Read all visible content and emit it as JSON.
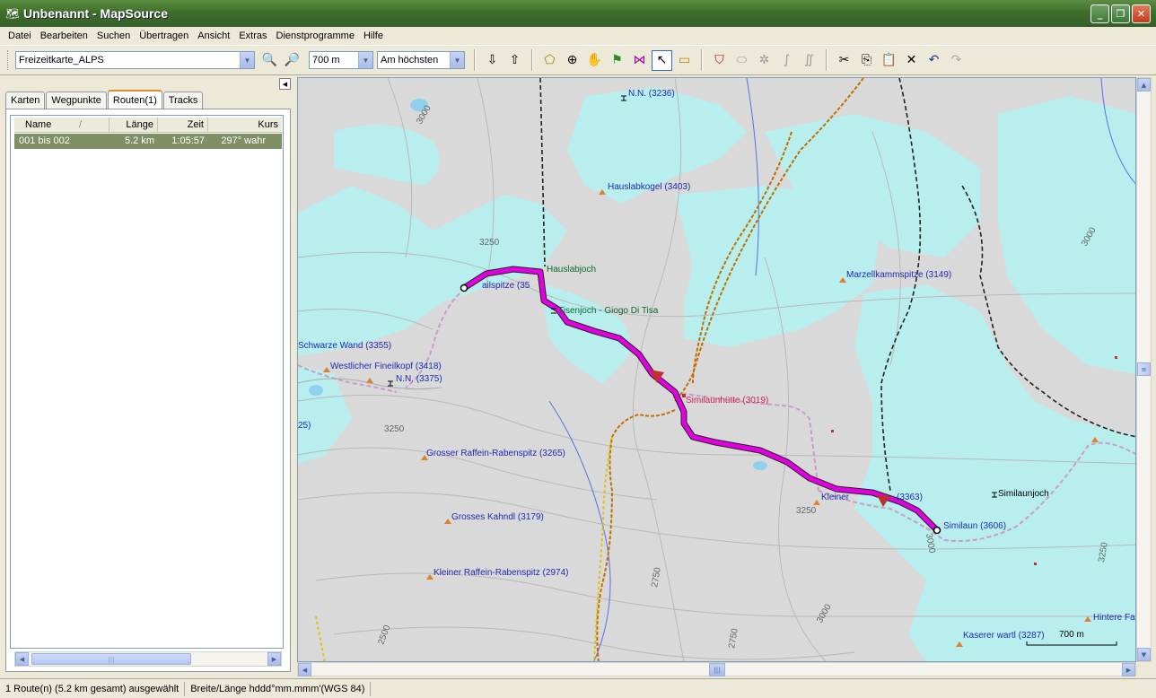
{
  "window": {
    "title": "Unbenannt - MapSource"
  },
  "menu": [
    "Datei",
    "Bearbeiten",
    "Suchen",
    "Übertragen",
    "Ansicht",
    "Extras",
    "Dienstprogramme",
    "Hilfe"
  ],
  "toolbar": {
    "map_product": "Freizeitkarte_ALPS",
    "zoom": "700 m",
    "detail": "Am höchsten"
  },
  "tabs": [
    "Karten",
    "Wegpunkte",
    "Routen(1)",
    "Tracks"
  ],
  "columns": [
    "Name",
    "Länge",
    "Zeit",
    "Kurs"
  ],
  "routes": [
    {
      "name": "001 bis 002",
      "length": "5.2 km",
      "time": "1:05:57",
      "course": "297° wahr"
    }
  ],
  "map": {
    "scale": "700 m",
    "labels": {
      "nn3236": "N.N. (3236)",
      "hauslabkogel": "Hauslabkogel (3403)",
      "hauslabjoch": "Hauslabjoch",
      "finailspitze": "ailspitze (35",
      "tisenjoch": "Tisenjoch - Giogo Di Tisa",
      "schwarze": "Schwarze Wand (3355)",
      "westlicher": "Westlicher Fineilkopf (3418)",
      "nn3375": "N.N. (3375)",
      "similaunhuette": "Similaunhütte (3019)",
      "grosserraffein": "Grosser Raffein-Rabenspitz (3265)",
      "grosseskahndl": "Grosses Kahndl (3179)",
      "kleinerraffein": "Kleiner Raffein-Rabenspitz (2974)",
      "marzell": "Marzellkammspitze (3149)",
      "similaunjoch": "Similaunjoch",
      "similaun": "Similaun (3606)",
      "kleiner": "Kleiner",
      "n3363": "(3363)",
      "kaserer": "Kaserer wartl (3287)",
      "hintere": "Hintere Fa",
      "p25": "25)",
      "c3000a": "3000",
      "c3250a": "3250",
      "c3250b": "3250",
      "c3250c": "3250",
      "c3000b": "3000",
      "c2500": "2500",
      "c2750a": "2750",
      "c3000c": "3000",
      "c2750b": "2750",
      "c3250d": "3250",
      "c3000d": "3000"
    }
  },
  "status": {
    "selection": "1 Route(n) (5.2 km gesamt) ausgewählt",
    "format": "Breite/Länge hddd°mm.mmm'(WGS 84)"
  }
}
